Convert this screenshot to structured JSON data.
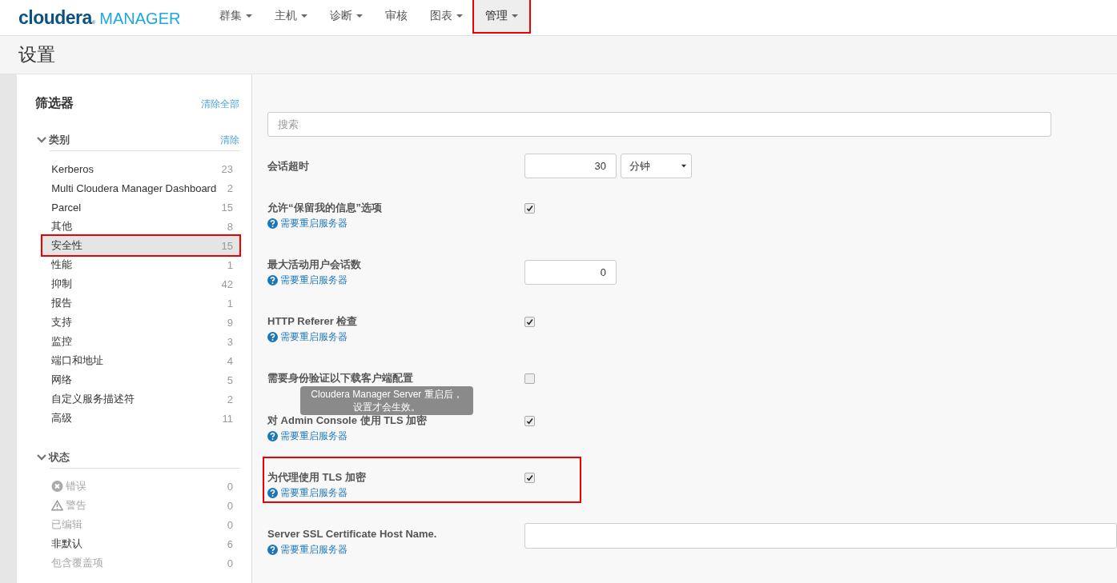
{
  "logo": {
    "brand": "cloudera",
    "registered": "®",
    "product": "MANAGER"
  },
  "nav": [
    {
      "label": "群集",
      "has_menu": true,
      "selected": false,
      "highlighted": false
    },
    {
      "label": "主机",
      "has_menu": true,
      "selected": false,
      "highlighted": false
    },
    {
      "label": "诊断",
      "has_menu": true,
      "selected": false,
      "highlighted": false
    },
    {
      "label": "审核",
      "has_menu": false,
      "selected": false,
      "highlighted": false
    },
    {
      "label": "图表",
      "has_menu": true,
      "selected": false,
      "highlighted": false
    },
    {
      "label": "管理",
      "has_menu": true,
      "selected": true,
      "highlighted": true
    }
  ],
  "page_title": "设置",
  "filter": {
    "title": "筛选器",
    "clear_all": "清除全部",
    "sections": [
      {
        "title": "类别",
        "expanded": true,
        "clear": "清除",
        "items": [
          {
            "label": "Kerberos",
            "count": "23",
            "selected": false,
            "disabled": false,
            "highlighted": false
          },
          {
            "label": "Multi Cloudera Manager Dashboard",
            "count": "2",
            "selected": false,
            "disabled": false,
            "highlighted": false
          },
          {
            "label": "Parcel",
            "count": "15",
            "selected": false,
            "disabled": false,
            "highlighted": false
          },
          {
            "label": "其他",
            "count": "8",
            "selected": false,
            "disabled": false,
            "highlighted": false
          },
          {
            "label": "安全性",
            "count": "15",
            "selected": true,
            "disabled": false,
            "highlighted": true
          },
          {
            "label": "性能",
            "count": "1",
            "selected": false,
            "disabled": false,
            "highlighted": false
          },
          {
            "label": "抑制",
            "count": "42",
            "selected": false,
            "disabled": false,
            "highlighted": false
          },
          {
            "label": "报告",
            "count": "1",
            "selected": false,
            "disabled": false,
            "highlighted": false
          },
          {
            "label": "支持",
            "count": "9",
            "selected": false,
            "disabled": false,
            "highlighted": false
          },
          {
            "label": "监控",
            "count": "3",
            "selected": false,
            "disabled": false,
            "highlighted": false
          },
          {
            "label": "端口和地址",
            "count": "4",
            "selected": false,
            "disabled": false,
            "highlighted": false
          },
          {
            "label": "网络",
            "count": "5",
            "selected": false,
            "disabled": false,
            "highlighted": false
          },
          {
            "label": "自定义服务描述符",
            "count": "2",
            "selected": false,
            "disabled": false,
            "highlighted": false
          },
          {
            "label": "高级",
            "count": "11",
            "selected": false,
            "disabled": false,
            "highlighted": false
          }
        ]
      },
      {
        "title": "状态",
        "expanded": true,
        "items": [
          {
            "label": "错误",
            "count": "0",
            "kind": "error",
            "selected": false,
            "disabled": true,
            "highlighted": false
          },
          {
            "label": "警告",
            "count": "0",
            "kind": "warning",
            "selected": false,
            "disabled": true,
            "highlighted": false
          },
          {
            "label": "已编辑",
            "count": "0",
            "selected": false,
            "disabled": true,
            "highlighted": false
          },
          {
            "label": "非默认",
            "count": "6",
            "selected": false,
            "disabled": false,
            "highlighted": false
          },
          {
            "label": "包含覆盖项",
            "count": "0",
            "selected": false,
            "disabled": true,
            "highlighted": false
          }
        ]
      }
    ]
  },
  "search": {
    "placeholder": "搜索"
  },
  "settings": [
    {
      "label": "会话超时",
      "kind": "number_unit",
      "value": "30",
      "unit": "分钟",
      "highlighted": false
    },
    {
      "label": "允许“保留我的信息”选项",
      "kind": "checkbox",
      "checked": true,
      "note": "需要重启服务器",
      "highlighted": false
    },
    {
      "label": "最大活动用户会话数",
      "kind": "number",
      "value": "0",
      "note": "需要重启服务器",
      "highlighted": false
    },
    {
      "label": "HTTP Referer 检查",
      "kind": "checkbox",
      "checked": true,
      "note": "需要重启服务器",
      "highlighted": false
    },
    {
      "label": "需要身份验证以下载客户端配置",
      "kind": "checkbox",
      "checked": false,
      "highlighted": false
    },
    {
      "label": "对 Admin Console 使用 TLS 加密",
      "kind": "checkbox",
      "checked": true,
      "note": "需要重启服务器",
      "highlighted": false,
      "tooltip": "Cloudera Manager Server 重启后，设置才会生效。"
    },
    {
      "label": "为代理使用 TLS 加密",
      "kind": "checkbox",
      "checked": true,
      "note": "需要重启服务器",
      "highlighted": true
    },
    {
      "label": "Server SSL Certificate Host Name.",
      "kind": "text",
      "note": "需要重启服务器",
      "highlighted": false
    }
  ]
}
